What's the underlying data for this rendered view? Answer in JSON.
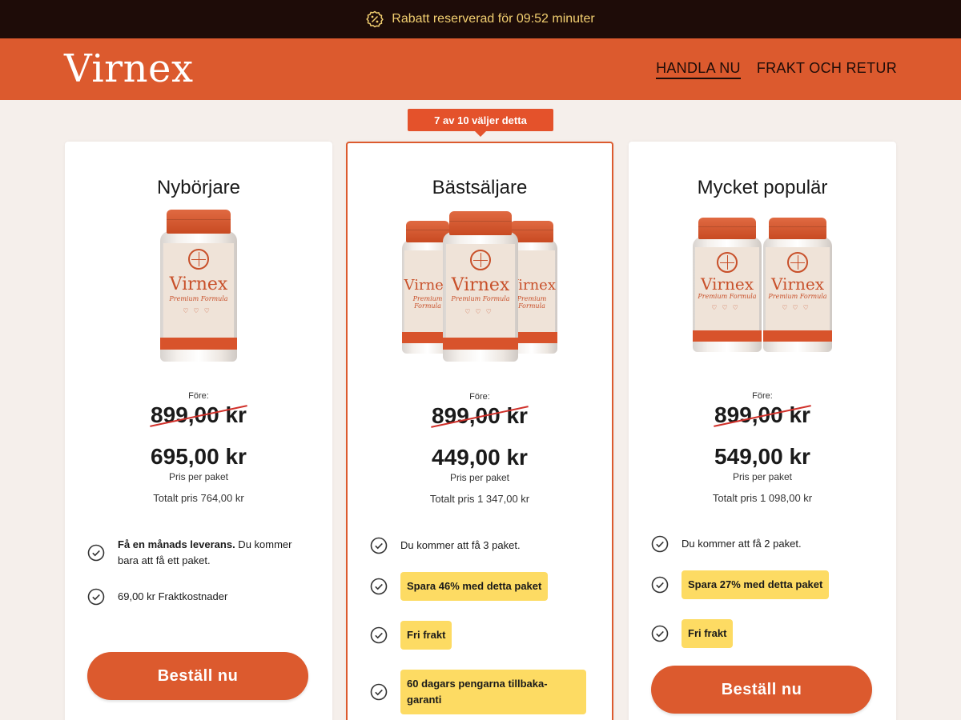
{
  "topbar": {
    "icon": "discount-badge-icon",
    "text": "Rabatt reserverad för 09:52 minuter",
    "color": "#f2cf70"
  },
  "header": {
    "logo": "Virnex",
    "nav": [
      {
        "label": "HANDLA NU",
        "active": true
      },
      {
        "label": "FRAKT OCH RETUR",
        "active": false
      }
    ],
    "color": "#dc5a2e"
  },
  "ribbon": "7 av 10 väljer detta",
  "bottle": {
    "brand": "Virnex",
    "subtitle": "Premium Formula"
  },
  "plans": [
    {
      "title": "Nybörjare",
      "bottle_count": 1,
      "before_label": "Före:",
      "old_price": "899,00 kr",
      "price": "695,00 kr",
      "per_label": "Pris per paket",
      "total": "Totalt pris 764,00 kr",
      "features": [
        {
          "bold": "Få en månads leverans.",
          "text": " Du kommer bara att få ett paket."
        },
        {
          "text": "69,00 kr Fraktkostnader"
        }
      ],
      "button": "Beställ nu"
    },
    {
      "title": "Bästsäljare",
      "bottle_count": 3,
      "before_label": "Före:",
      "old_price": "899,00 kr",
      "price": "449,00 kr",
      "per_label": "Pris per paket",
      "total": "Totalt pris 1 347,00 kr",
      "features": [
        {
          "text": "Du kommer att få 3 paket."
        },
        {
          "pill": "Spara 46% med detta paket"
        },
        {
          "pill": "Fri frakt"
        },
        {
          "pill": "60 dagars pengarna tillbaka-garanti"
        }
      ]
    },
    {
      "title": "Mycket populär",
      "bottle_count": 2,
      "before_label": "Före:",
      "old_price": "899,00 kr",
      "price": "549,00 kr",
      "per_label": "Pris per paket",
      "total": "Totalt pris 1 098,00 kr",
      "features": [
        {
          "text": "Du kommer att få 2 paket."
        },
        {
          "pill": "Spara 27% med detta paket"
        },
        {
          "pill": "Fri frakt"
        }
      ],
      "button": "Beställ nu"
    }
  ],
  "colors": {
    "accent": "#dc5a2e",
    "highlight": "#fddb63",
    "strike": "#d0302a"
  }
}
